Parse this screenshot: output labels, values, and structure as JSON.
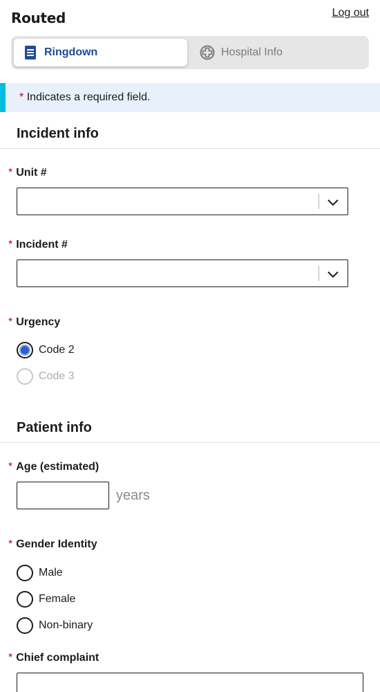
{
  "header": {
    "logo": "Routed",
    "logout_label": "Log out"
  },
  "tabs": [
    {
      "label": "Ringdown",
      "active": true,
      "icon": "document-icon"
    },
    {
      "label": "Hospital Info",
      "active": false,
      "icon": "hospital-cross-icon"
    }
  ],
  "required_note": {
    "asterisk": "*",
    "text": "Indicates a required field."
  },
  "incident_info": {
    "title": "Incident info",
    "unit": {
      "label": "Unit #",
      "value": ""
    },
    "incident": {
      "label": "Incident #",
      "value": ""
    },
    "urgency": {
      "label": "Urgency",
      "options": [
        {
          "label": "Code 2",
          "selected": true,
          "disabled": false
        },
        {
          "label": "Code 3",
          "selected": false,
          "disabled": true
        }
      ]
    }
  },
  "patient_info": {
    "title": "Patient info",
    "age": {
      "label": "Age (estimated)",
      "value": "",
      "unit": "years"
    },
    "gender": {
      "label": "Gender Identity",
      "options": [
        {
          "label": "Male",
          "selected": false
        },
        {
          "label": "Female",
          "selected": false
        },
        {
          "label": "Non-binary",
          "selected": false
        }
      ]
    },
    "chief_complaint": {
      "label": "Chief complaint",
      "value": ""
    }
  },
  "colors": {
    "accent": "#1e4a9a",
    "alert_border": "#00bde3",
    "alert_bg": "#e8f1fb",
    "required": "#b50909",
    "radio_selected": "#2e5ec9"
  }
}
